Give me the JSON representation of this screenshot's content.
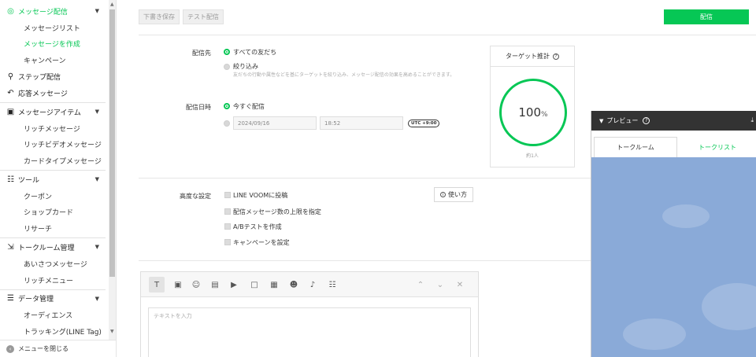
{
  "sidebar": {
    "items": [
      {
        "label": "メッセージ配信",
        "type": "section",
        "icon": "broadcast-icon",
        "glyph": "◎",
        "caret": true,
        "active": true
      },
      {
        "label": "メッセージリスト",
        "type": "sub"
      },
      {
        "label": "メッセージを作成",
        "type": "sub",
        "active": true
      },
      {
        "label": "キャンペーン",
        "type": "sub"
      },
      {
        "label": "ステップ配信",
        "type": "section",
        "icon": "step-icon",
        "glyph": "⚲"
      },
      {
        "label": "応答メッセージ",
        "type": "section",
        "icon": "reply-icon",
        "glyph": "↶"
      },
      {
        "label": "メッセージアイテム",
        "type": "section",
        "icon": "message-item-icon",
        "glyph": "▣",
        "caret": true
      },
      {
        "label": "リッチメッセージ",
        "type": "sub"
      },
      {
        "label": "リッチビデオメッセージ",
        "type": "sub"
      },
      {
        "label": "カードタイプメッセージ",
        "type": "sub"
      },
      {
        "label": "ツール",
        "type": "section",
        "icon": "tool-icon",
        "glyph": "☷",
        "caret": true
      },
      {
        "label": "クーポン",
        "type": "sub"
      },
      {
        "label": "ショップカード",
        "type": "sub"
      },
      {
        "label": "リサーチ",
        "type": "sub"
      },
      {
        "label": "トークルーム管理",
        "type": "section",
        "icon": "talkroom-icon",
        "glyph": "⇲",
        "caret": true
      },
      {
        "label": "あいさつメッセージ",
        "type": "sub"
      },
      {
        "label": "リッチメニュー",
        "type": "sub"
      },
      {
        "label": "データ管理",
        "type": "section",
        "icon": "database-icon",
        "glyph": "☰",
        "caret": true
      },
      {
        "label": "オーディエンス",
        "type": "sub"
      },
      {
        "label": "トラッキング(LINE Tag)",
        "type": "sub"
      }
    ],
    "close_menu": "メニューを閉じる"
  },
  "toolbar": {
    "draft_save": "下書き保存",
    "test_send": "テスト配信",
    "deliver": "配信"
  },
  "delivery_target": {
    "label": "配信先",
    "all_friends": "すべての友だち",
    "filter": "絞り込み",
    "filter_desc": "友だちの行動や属性などを基にターゲットを絞り込み、メッセージ配信の効果を高めることができます。"
  },
  "delivery_time": {
    "label": "配信日時",
    "now": "今すぐ配信",
    "date": "2024/09/16",
    "time": "18:52",
    "timezone": "UTC +9:00"
  },
  "advanced": {
    "label": "高度な設定",
    "options": [
      "LINE VOOMに投稿",
      "配信メッセージ数の上限を指定",
      "A/Bテストを作成",
      "キャンペーンを設定"
    ],
    "howto": "使い方"
  },
  "target_estimate": {
    "title": "ターゲット推計",
    "percent": "100",
    "unit": "%",
    "approx": "約1人"
  },
  "editor": {
    "placeholder": "テキストを入力",
    "tools": [
      "text-icon",
      "image-icon",
      "sticker-icon",
      "coupon-icon",
      "video-icon",
      "richmessage-icon",
      "richvideo-icon",
      "emoji-icon",
      "voice-icon",
      "research-icon"
    ]
  },
  "preview": {
    "title": "プレビュー",
    "tab_talkroom": "トークルーム",
    "tab_talklist": "トークリスト"
  },
  "colors": {
    "accent": "#06c755",
    "preview_bg": "#8aaad8",
    "preview_header": "#333333"
  }
}
